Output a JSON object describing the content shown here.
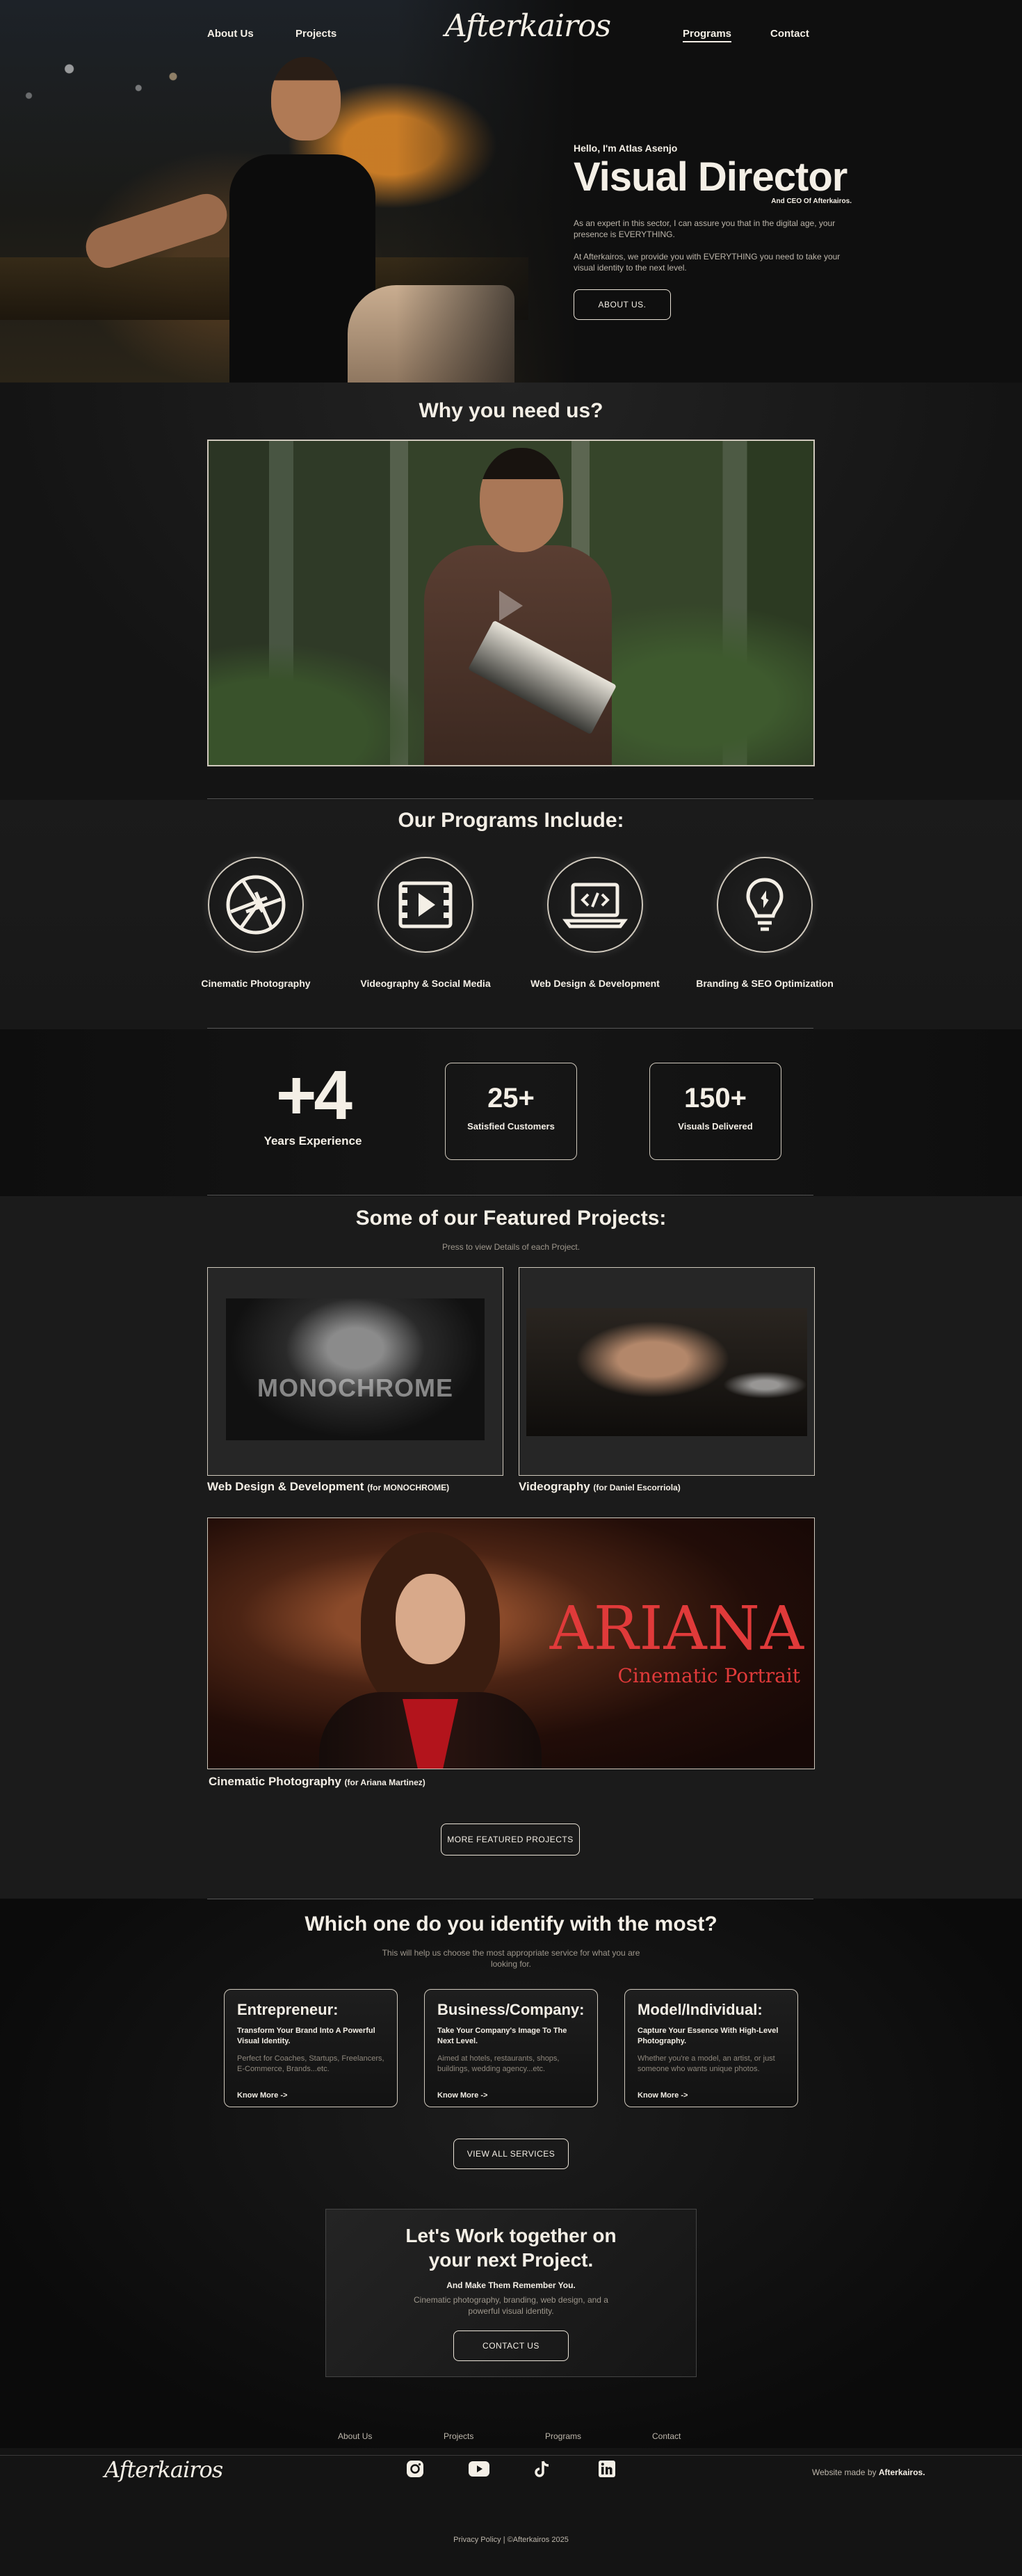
{
  "nav": {
    "about": "About Us",
    "projects": "Projects",
    "programs": "Programs",
    "contact": "Contact",
    "logo": "Afterkairos"
  },
  "hero": {
    "hello": "Hello, I'm Atlas Asenjo",
    "title": "Visual Director",
    "subtitle": "And CEO Of Afterkairos.",
    "p1": "As an expert in this sector, I can assure you that in the digital age, your presence is EVERYTHING.",
    "p2": "At Afterkairos, we provide you with EVERYTHING you need to take your visual identity to the next level.",
    "button": "ABOUT US."
  },
  "why": {
    "title": "Why you need us?"
  },
  "programs": {
    "title": "Our Programs Include:",
    "items": [
      {
        "label": "Cinematic Photography",
        "icon": "camera-aperture-icon"
      },
      {
        "label": "Videography & Social Media",
        "icon": "film-icon"
      },
      {
        "label": "Web Design & Development",
        "icon": "laptop-code-icon"
      },
      {
        "label": "Branding & SEO Optimization",
        "icon": "lightbulb-icon"
      }
    ]
  },
  "stats": {
    "years_num": "+4",
    "years_label": "Years Experience",
    "customers_num": "25+",
    "customers_label": "Satisfied Customers",
    "visuals_num": "150+",
    "visuals_label": "Visuals Delivered"
  },
  "featured": {
    "title": "Some of our Featured Projects:",
    "hint": "Press to view Details of each Project.",
    "p1_title": "Web Design & Development",
    "p1_for": "(for  MONOCHROME)",
    "p1_image_word": "MONOCHROME",
    "p2_title": "Videography",
    "p2_for": "(for Daniel Escorriola)",
    "p3_title": "Cinematic Photography",
    "p3_for": "(for Ariana Martinez)",
    "p3_image_title": "ARIANA",
    "p3_image_sub": "Cinematic Portrait",
    "more_button": "MORE FEATURED PROJECTS"
  },
  "identify": {
    "title": "Which one do you identify with the most?",
    "subtitle": "This will help us choose the most appropriate service for what you are looking for.",
    "cards": [
      {
        "title": "Entrepreneur:",
        "strong": "Transform Your Brand Into A Powerful Visual Identity.",
        "text": "Perfect for Coaches, Startups, Freelancers, E-Commerce, Brands...etc.",
        "link": "Know More ->"
      },
      {
        "title": "Business/Company:",
        "strong": "Take Your Company's Image To The Next Level.",
        "text": "Aimed at hotels, restaurants, shops, buildings, wedding agency...etc.",
        "link": "Know More ->"
      },
      {
        "title": "Model/Individual:",
        "strong": "Capture Your Essence With High-Level Photography.",
        "text": "Whether you're a model, an artist, or just someone who wants unique photos.",
        "link": "Know More ->"
      }
    ],
    "services_button": "VIEW ALL SERVICES"
  },
  "cta": {
    "title": "Let's Work together on your next Project.",
    "strong": "And Make Them Remember You.",
    "text": "Cinematic photography, branding, web design, and a powerful visual identity.",
    "button": "CONTACT US"
  },
  "footer": {
    "nav": [
      "About Us",
      "Projects",
      "Programs",
      "Contact"
    ],
    "logo": "Afterkairos",
    "credit_prefix": "Website made by",
    "credit_brand": "Afterkairos.",
    "legal": "Privacy Policy | ©Afterkairos 2025",
    "socials": [
      "instagram-icon",
      "youtube-icon",
      "tiktok-icon",
      "linkedin-icon"
    ]
  },
  "colors": {
    "background": "#111111",
    "text": "#f4efe6",
    "accent_red": "#e03a3a",
    "muted": "#9e978c"
  }
}
